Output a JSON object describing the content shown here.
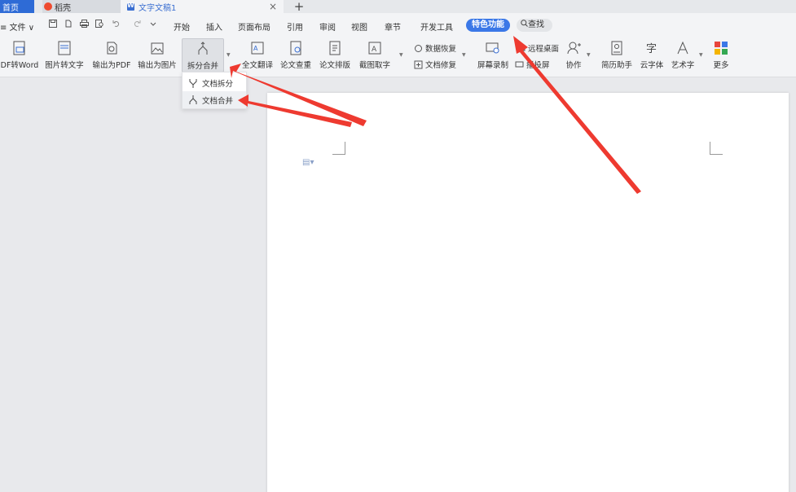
{
  "tabs": {
    "home": "首页",
    "daoke": "稻壳",
    "doc": "文字文稿1",
    "add": "+",
    "close": "×"
  },
  "menu": {
    "file": "≡ 文件 ∨",
    "items": [
      "开始",
      "插入",
      "页面布局",
      "引用",
      "审阅",
      "视图",
      "章节",
      "开发工具"
    ],
    "special": "特色功能",
    "search": "查找"
  },
  "toolbar": {
    "pdf_to_word": "DF转Word",
    "img_to_text": "图片转文字",
    "export_pdf": "输出为PDF",
    "export_img": "输出为图片",
    "split_merge": "拆分合并",
    "translate": "全文翻译",
    "paper_check": "论文查重",
    "paper_layout": "论文排版",
    "screenshot_ocr": "截图取字",
    "data_recovery": "数据恢复",
    "doc_repair": "文档修复",
    "screen_record": "屏幕录制",
    "remote_desktop": "远程桌面",
    "cast_screen": "播投屏",
    "collab": "协作",
    "resume": "简历助手",
    "cloud_font": "云字体",
    "art_text": "艺术字",
    "more": "更多"
  },
  "dropdown": {
    "split": "文档拆分",
    "merge": "文档合并"
  },
  "colors": {
    "accent": "#3b78e7",
    "arrow": "#ee3a30",
    "tab_home": "#2e6bd6"
  }
}
